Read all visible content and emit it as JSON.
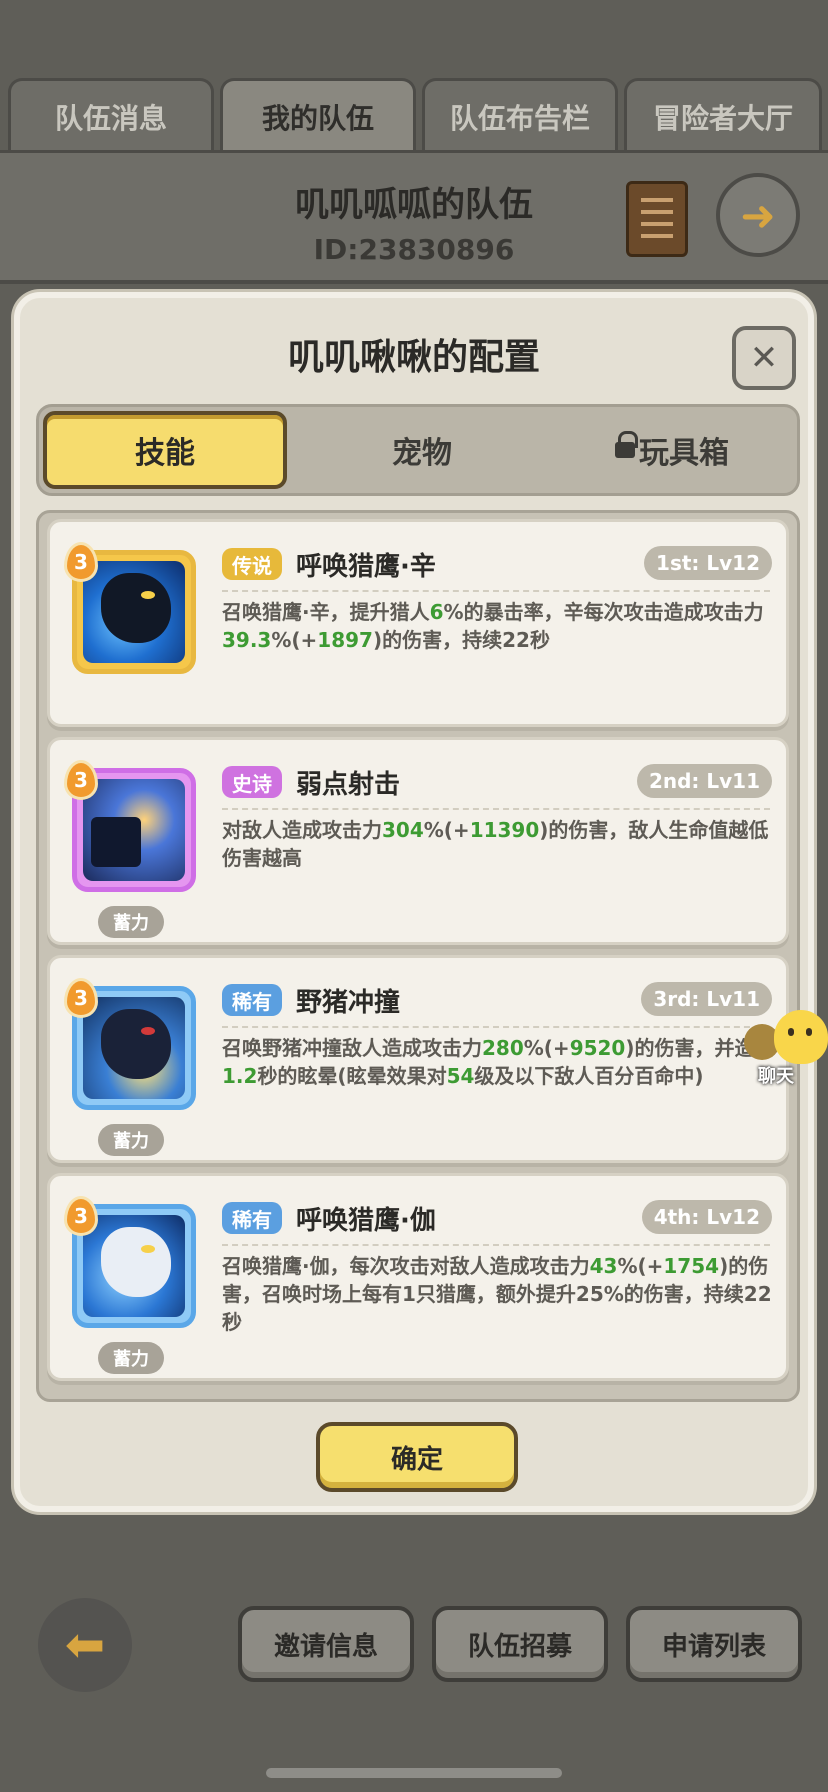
{
  "top_tabs": [
    {
      "label": "队伍消息",
      "active": false
    },
    {
      "label": "我的队伍",
      "active": true
    },
    {
      "label": "队伍布告栏",
      "active": false
    },
    {
      "label": "冒险者大厅",
      "active": false
    }
  ],
  "team": {
    "name": "叽叽呱呱的队伍",
    "id": "ID:23830896"
  },
  "modal": {
    "title": "叽叽啾啾的配置",
    "close_label": "✕",
    "tabs": [
      {
        "label": "技能",
        "active": true,
        "locked": false
      },
      {
        "label": "宠物",
        "active": false,
        "locked": false
      },
      {
        "label": "玩具箱",
        "active": false,
        "locked": true
      }
    ],
    "skills": [
      {
        "level": "3",
        "rarity": "传说",
        "rarity_color": "#e7b93a",
        "name": "呼唤猎鹰·辛",
        "slot": "1st: Lv12",
        "charge": "",
        "desc_parts": [
          {
            "t": "召唤猎鹰·辛，提升猎人",
            "num": false
          },
          {
            "t": "6",
            "num": true
          },
          {
            "t": "%的暴击率，辛每次攻击造成攻击力",
            "num": false
          },
          {
            "t": "39.3",
            "num": true
          },
          {
            "t": "%(+",
            "num": false
          },
          {
            "t": "1897",
            "num": true
          },
          {
            "t": ")的伤害，持续22秒",
            "num": false
          }
        ]
      },
      {
        "level": "3",
        "rarity": "史诗",
        "rarity_color": "#cf72e0",
        "name": "弱点射击",
        "slot": "2nd: Lv11",
        "charge": "蓄力",
        "desc_parts": [
          {
            "t": "对敌人造成攻击力",
            "num": false
          },
          {
            "t": "304",
            "num": true
          },
          {
            "t": "%(+",
            "num": false
          },
          {
            "t": "11390",
            "num": true
          },
          {
            "t": ")的伤害，敌人生命值越低伤害越高",
            "num": false
          }
        ]
      },
      {
        "level": "3",
        "rarity": "稀有",
        "rarity_color": "#5b9fe0",
        "name": "野猪冲撞",
        "slot": "3rd: Lv11",
        "charge": "蓄力",
        "desc_parts": [
          {
            "t": "召唤野猪冲撞敌人造成攻击力",
            "num": false
          },
          {
            "t": "280",
            "num": true
          },
          {
            "t": "%(+",
            "num": false
          },
          {
            "t": "9520",
            "num": true
          },
          {
            "t": ")的伤害，并造成",
            "num": false
          },
          {
            "t": "1.2",
            "num": true
          },
          {
            "t": "秒的眩晕(眩晕效果对",
            "num": false
          },
          {
            "t": "54",
            "num": true
          },
          {
            "t": "级及以下敌人百分百命中)",
            "num": false
          }
        ]
      },
      {
        "level": "3",
        "rarity": "稀有",
        "rarity_color": "#5b9fe0",
        "name": "呼唤猎鹰·伽",
        "slot": "4th: Lv12",
        "charge": "蓄力",
        "desc_parts": [
          {
            "t": "召唤猎鹰·伽，每次攻击对敌人造成攻击力",
            "num": false
          },
          {
            "t": "43",
            "num": true
          },
          {
            "t": "%(+",
            "num": false
          },
          {
            "t": "1754",
            "num": true
          },
          {
            "t": ")的伤害，召唤时场上每有1只猎鹰，额外提升25%的伤害，持续22秒",
            "num": false
          }
        ]
      }
    ],
    "confirm_label": "确定"
  },
  "chat": {
    "label": "聊天"
  },
  "bottom_bar": {
    "buttons": [
      "邀请信息",
      "队伍招募",
      "申请列表"
    ]
  }
}
